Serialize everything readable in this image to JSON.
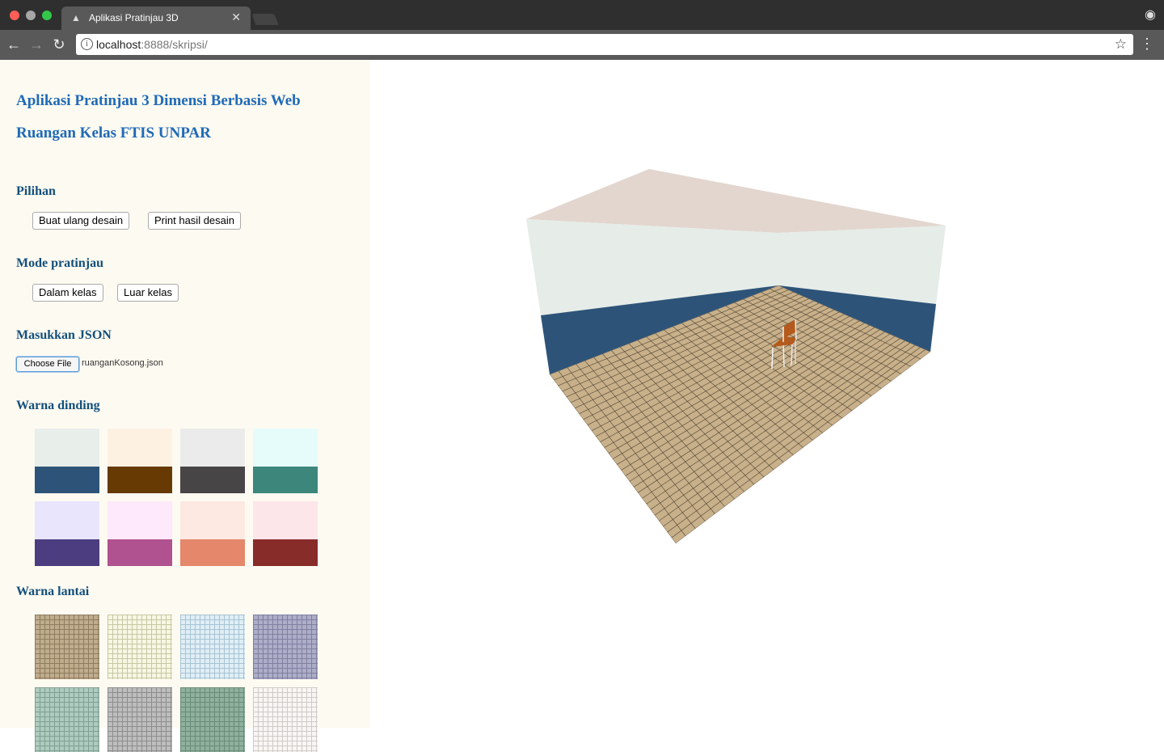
{
  "browser": {
    "tab_title": "Aplikasi Pratinjau 3D",
    "url_host": "localhost",
    "url_rest": ":8888/skripsi/"
  },
  "sidebar": {
    "title_line1": "Aplikasi Pratinjau 3 Dimensi Berbasis Web",
    "title_line2": "Ruangan Kelas FTIS UNPAR",
    "options_heading": "Pilihan",
    "rebuild_button": "Buat ulang desain",
    "print_button": "Print hasil desain",
    "mode_heading": "Mode pratinjau",
    "inside_button": "Dalam kelas",
    "outside_button": "Luar kelas",
    "json_heading": "Masukkan JSON",
    "file_button": "Choose File",
    "file_name": "ruanganKosong.json",
    "wall_heading": "Warna dinding",
    "floor_heading": "Warna lantai"
  },
  "wall_swatches": [
    {
      "top": "#e8eeea",
      "bottom": "#2d5478"
    },
    {
      "top": "#fdf1e1",
      "bottom": "#663a02"
    },
    {
      "top": "#ebebeb",
      "bottom": "#474546"
    },
    {
      "top": "#e5fcfb",
      "bottom": "#3c867c"
    },
    {
      "top": "#e9e5fd",
      "bottom": "#4b3d80"
    },
    {
      "top": "#fde9fb",
      "bottom": "#b0528f"
    },
    {
      "top": "#fde9e1",
      "bottom": "#e4876a"
    },
    {
      "top": "#fde6ea",
      "bottom": "#882c2a"
    }
  ],
  "floor_swatches": [
    {
      "color": "#bfac8c",
      "line": "#8e7c60"
    },
    {
      "color": "#f6f6e2",
      "line": "#c6c8a4"
    },
    {
      "color": "#dfeef6",
      "line": "#a8c3d2"
    },
    {
      "color": "#adadc8",
      "line": "#7f7fa0"
    },
    {
      "color": "#aecbbf",
      "line": "#7fa091"
    },
    {
      "color": "#bdbdbd",
      "line": "#8d8d8d"
    },
    {
      "color": "#8fb09c",
      "line": "#6a8b77"
    },
    {
      "color": "#f8f6f4",
      "line": "#cfcac6"
    }
  ],
  "scene": {
    "ceiling_color": "#e2d6cf",
    "wall_upper_color": "#e6ece8",
    "wall_lower_color": "#2d5478",
    "floor_color": "#c8b08a",
    "grid_color": "#3d3426",
    "chair_seat_color": "#b45a1c"
  }
}
